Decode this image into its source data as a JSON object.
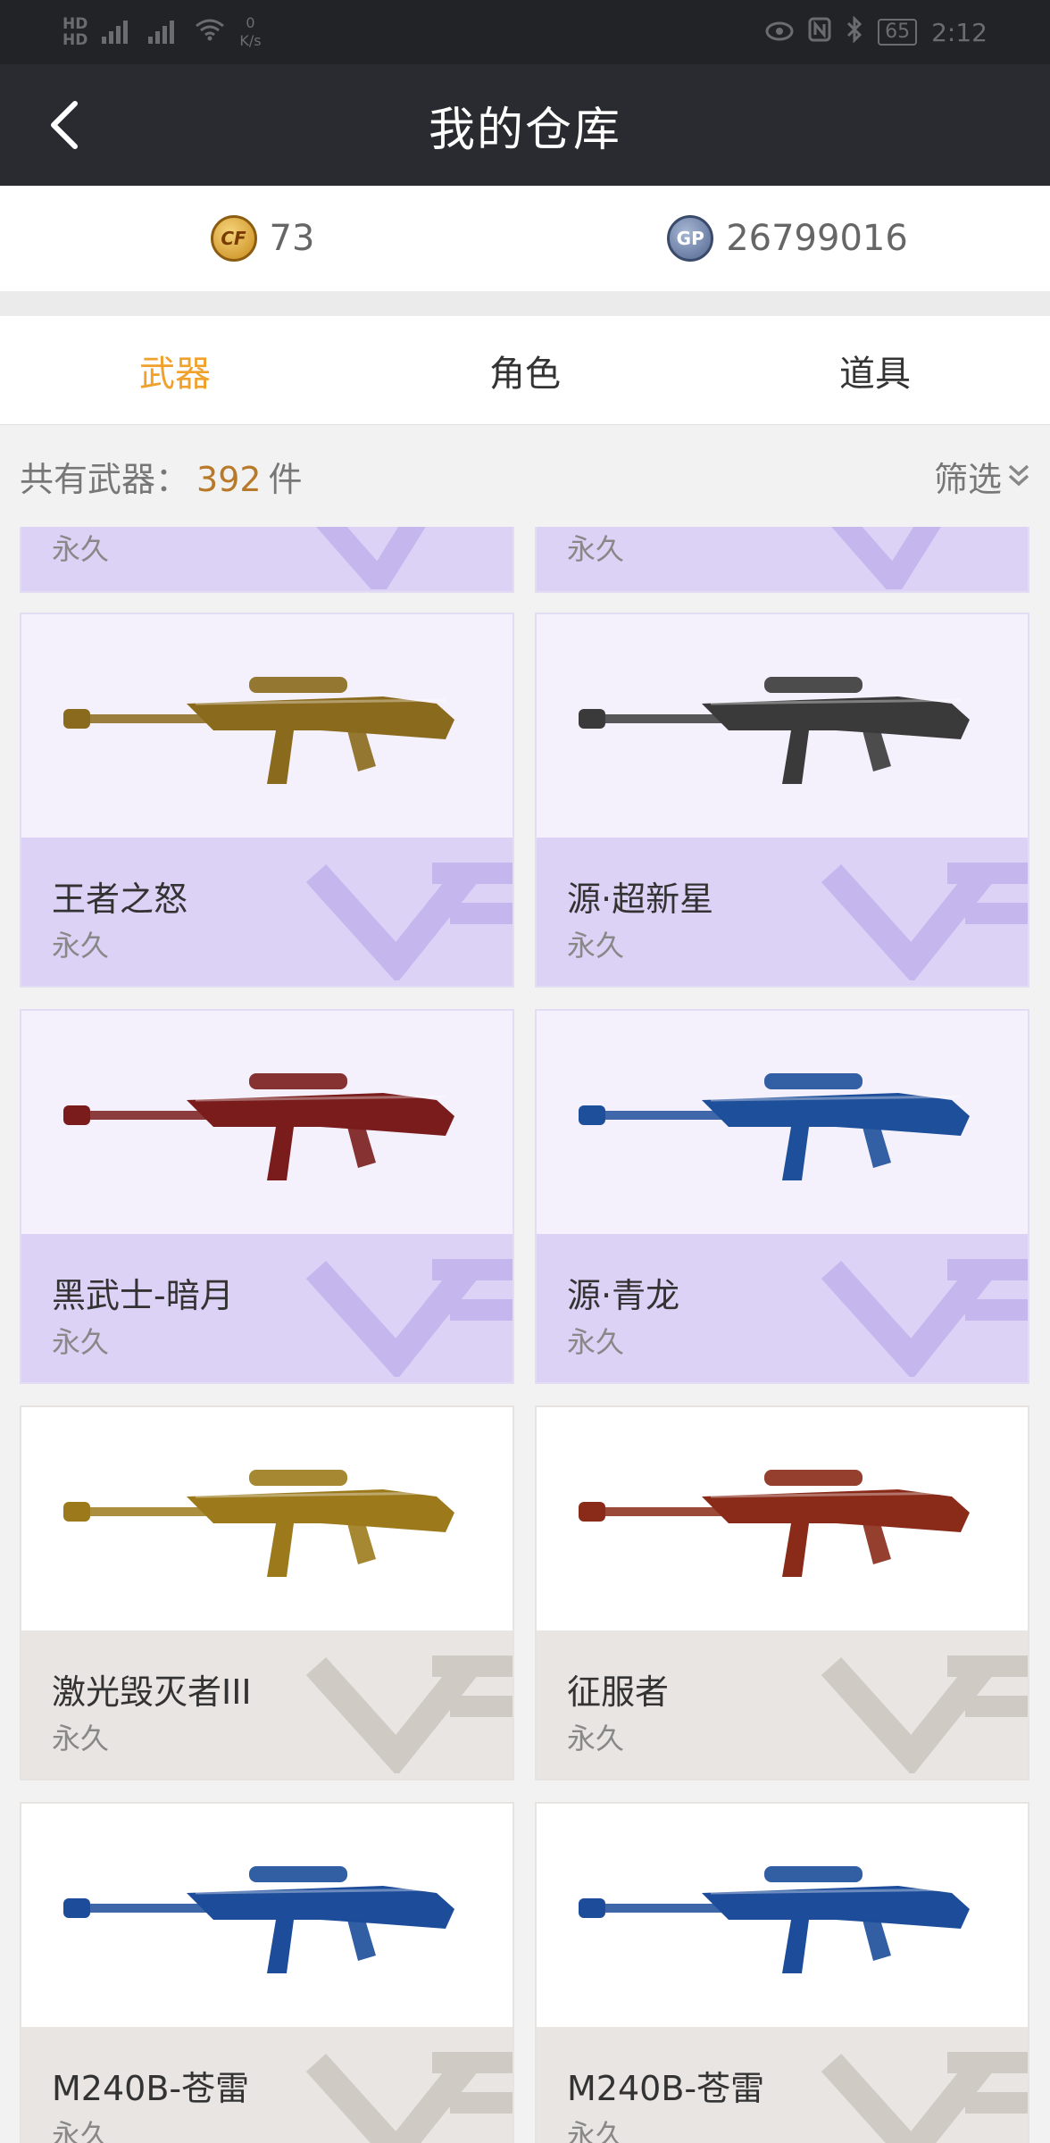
{
  "status_bar": {
    "hd1": "HD",
    "hd2": "HD",
    "net_speed": "0",
    "net_unit": "K/s",
    "battery": "65",
    "time": "2:12"
  },
  "header": {
    "title": "我的仓库"
  },
  "currency": {
    "cf_points": "73",
    "gp_points": "26799016",
    "cf_icon": "cf-coin-icon",
    "gp_icon_label": "GP"
  },
  "tabs": [
    {
      "label": "武器",
      "active": true
    },
    {
      "label": "角色",
      "active": false
    },
    {
      "label": "道具",
      "active": false
    }
  ],
  "summary": {
    "label": "共有武器：",
    "count": "392",
    "unit": "件",
    "filter_label": "筛选"
  },
  "partial_row": [
    {
      "duration": "永久"
    },
    {
      "duration": "永久"
    }
  ],
  "items": [
    {
      "name": "王者之怒",
      "duration": "永久",
      "style": "purple",
      "gun_color": "#8a6a1c"
    },
    {
      "name": "源·超新星",
      "duration": "永久",
      "style": "purple",
      "gun_color": "#3a3a3a"
    },
    {
      "name": "黑武士-暗月",
      "duration": "永久",
      "style": "purple",
      "gun_color": "#7a1c1c"
    },
    {
      "name": "源·青龙",
      "duration": "永久",
      "style": "purple",
      "gun_color": "#1e4f9a"
    },
    {
      "name": "激光毁灭者III",
      "duration": "永久",
      "style": "gray",
      "gun_color": "#9c7a1c"
    },
    {
      "name": "征服者",
      "duration": "永久",
      "style": "gray",
      "gun_color": "#8a2a18"
    },
    {
      "name": "M240B-苍雷",
      "duration": "永久",
      "style": "gray",
      "gun_color": "#1c4c9a"
    },
    {
      "name": "M240B-苍雷",
      "duration": "永久",
      "style": "gray",
      "gun_color": "#1c4c9a"
    }
  ]
}
